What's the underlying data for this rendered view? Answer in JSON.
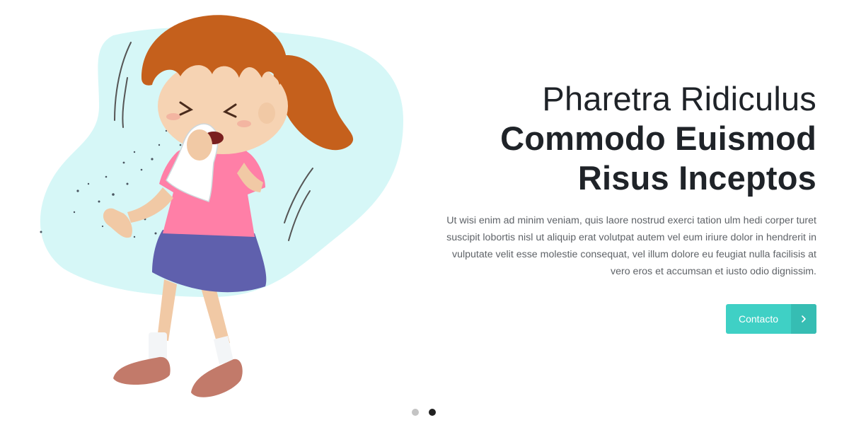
{
  "hero": {
    "title_line1": "Pharetra Ridiculus",
    "title_line2": "Commodo Euismod",
    "title_line3": "Risus Inceptos",
    "description": "Ut wisi enim ad minim veniam, quis laore nostrud exerci tation ulm hedi corper turet suscipit lobortis nisl ut aliquip erat volutpat autem vel eum iriure dolor in hendrerit in vulputate velit esse molestie consequat, vel illum dolore eu feugiat nulla facilisis at vero eros et accumsan et iusto odio dignissim.",
    "cta_label": "Contacto",
    "cta_icon": "chevron-right-icon",
    "illustration": "girl-sneezing-illustration"
  },
  "carousel": {
    "slide_count": 2,
    "active_index": 1
  },
  "colors": {
    "accent": "#3fd0c5",
    "accent_dark": "#36bdb3",
    "blob": "#d6f7f7",
    "heading": "#1f2328",
    "body_text": "#5f6368"
  }
}
